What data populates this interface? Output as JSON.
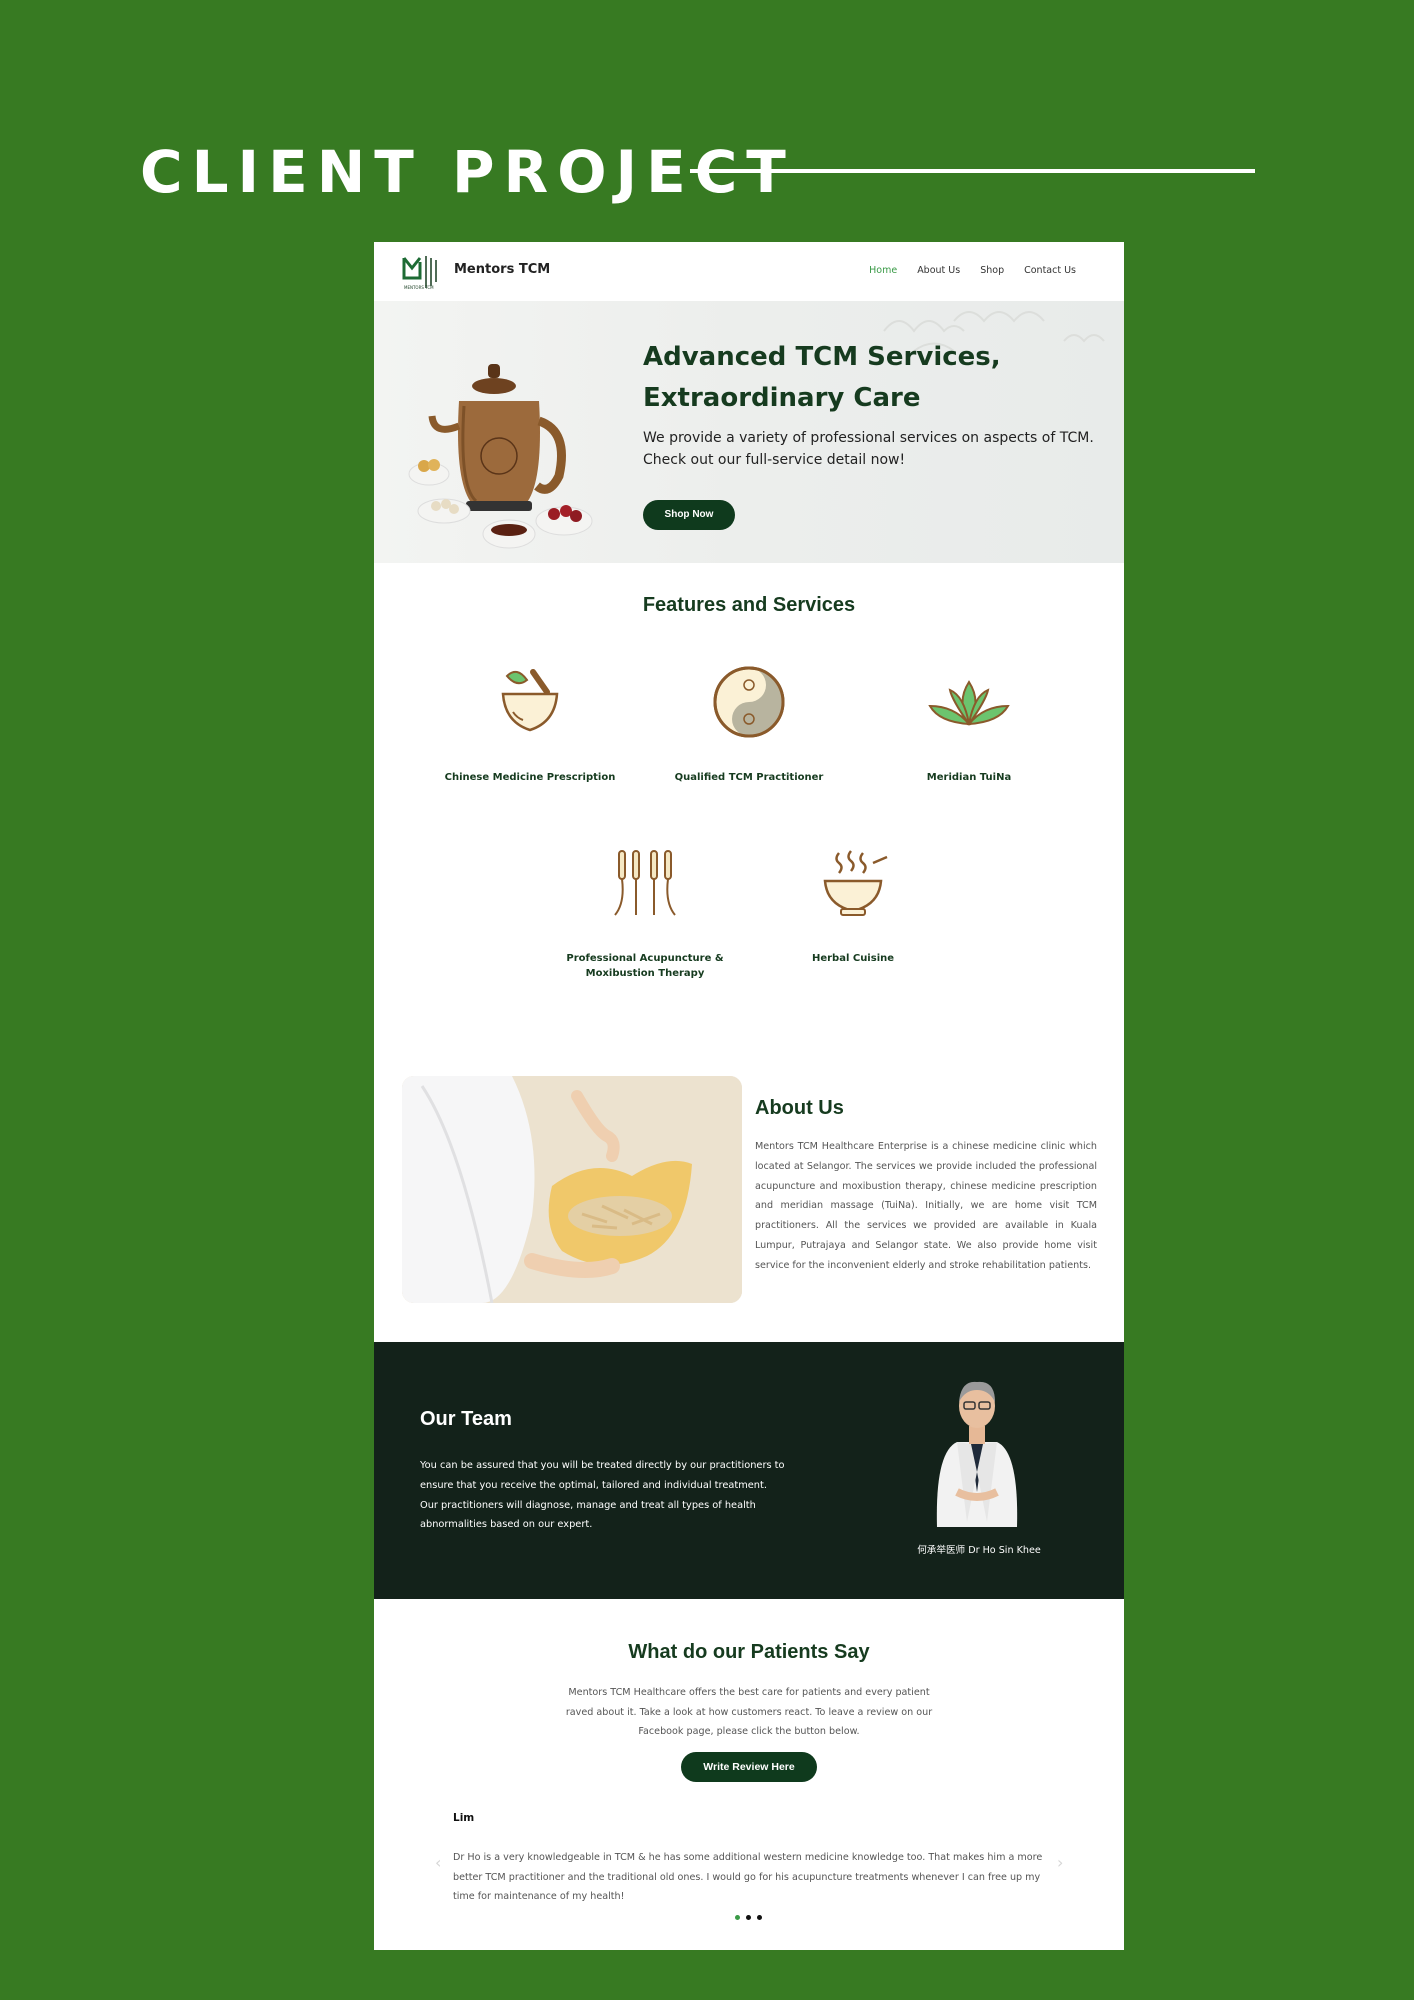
{
  "headline": "CLIENT PROJECT",
  "nav": {
    "brand": "Mentors TCM",
    "logo_caption": "MENTORS TCM",
    "items": [
      {
        "label": "Home",
        "active": true
      },
      {
        "label": "About Us",
        "active": false
      },
      {
        "label": "Shop",
        "active": false
      },
      {
        "label": "Contact Us",
        "active": false
      }
    ]
  },
  "hero": {
    "title_line1": "Advanced TCM Services,",
    "title_line2": "Extraordinary Care",
    "subtitle_line1": "We provide a variety of professional services on aspects of TCM.",
    "subtitle_line2": "Check out our full-service detail now!",
    "button": "Shop Now"
  },
  "features": {
    "title": "Features and Services",
    "items": [
      {
        "label_line1": "Chinese Medicine Prescription",
        "label_line2": "",
        "icon": "mortar-pestle-icon"
      },
      {
        "label_line1": "Qualified TCM Practitioner",
        "label_line2": "",
        "icon": "yin-yang-icon"
      },
      {
        "label_line1": "Meridian TuiNa",
        "label_line2": "",
        "icon": "lotus-icon"
      },
      {
        "label_line1": "Professional Acupuncture &",
        "label_line2": "Moxibustion Therapy",
        "icon": "acupuncture-needles-icon"
      },
      {
        "label_line1": "Herbal Cuisine",
        "label_line2": "",
        "icon": "herbal-soup-bowl-icon"
      }
    ]
  },
  "about": {
    "title": "About Us",
    "body": "Mentors TCM Healthcare Enterprise is a chinese medicine clinic which located at Selangor. The services we provide included the professional acupuncture and moxibustion therapy, chinese medicine prescription and meridian massage (TuiNa). Initially, we are home visit TCM practitioners. All the services we provided are available in Kuala Lumpur, Putrajaya and Selangor state. We also provide home visit service for the inconvenient elderly and stroke rehabilitation patients."
  },
  "team": {
    "title": "Our Team",
    "body": "You can be assured that you will be treated directly by our practitioners to ensure that you receive the optimal, tailored and individual treatment. Our practitioners will diagnose, manage and treat all types of health abnormalities based on our expert.",
    "doctor_name": "何承举医师 Dr Ho Sin Khee"
  },
  "reviews": {
    "title": "What do our Patients Say",
    "intro": "Mentors TCM Healthcare offers the best care for patients and every patient raved about it. Take a look at how customers react. To leave a review on our Facebook page, please click the button below.",
    "button": "Write Review Here",
    "current": {
      "name": "Lim",
      "text": "Dr Ho is a very knowledgeable in TCM & he has some additional western medicine knowledge too. That makes him a more better TCM practitioner and the traditional old ones. I would go for his acupuncture treatments whenever I can free up my time for maintenance of my health!"
    },
    "prev_arrow": "‹",
    "next_arrow": "›",
    "dots_total": 3,
    "active_dot": 1
  },
  "colors": {
    "page_bg": "#377a22",
    "brand_dark": "#163b1f",
    "button_bg": "#0f3a1d",
    "team_bg": "#13221a",
    "nav_active": "#3a9a47",
    "icon_brown": "#8a5a2b"
  }
}
